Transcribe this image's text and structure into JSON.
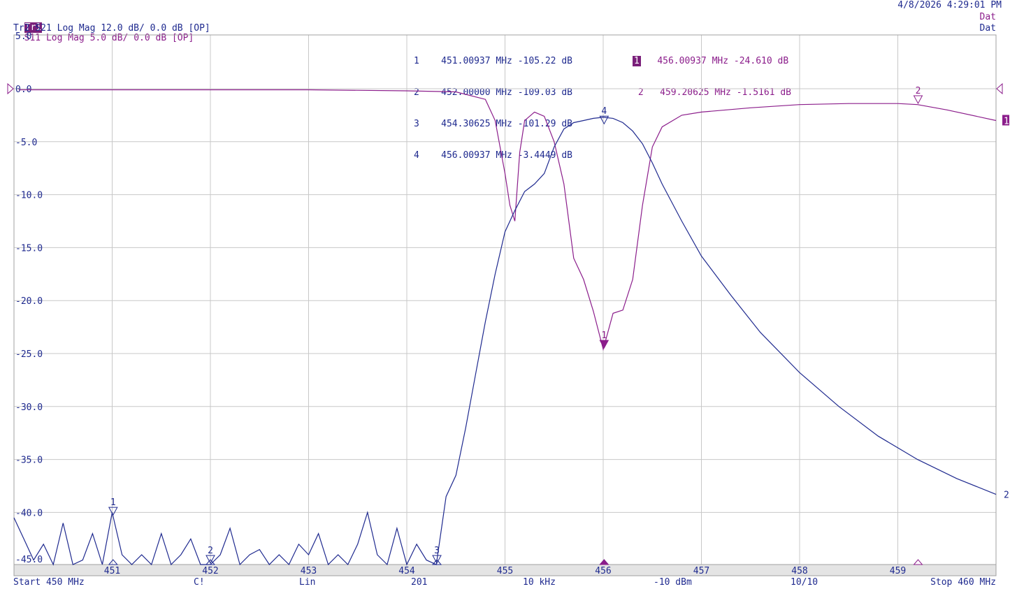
{
  "header": {
    "tr1_badge": "Tr1",
    "tr1_text": "S11 Log Mag 5.0 dB/ 0.0 dB [OP]",
    "tr2_text": "Tr2 S21 Log Mag 12.0 dB/ 0.0 dB [OP]",
    "datetime": "4/8/2026 4:29:01 PM",
    "dat1": "Dat",
    "dat2": "Dat"
  },
  "footer": {
    "start": "Start 450 MHz",
    "cal": "C!",
    "sweep": "Lin",
    "points": "201",
    "ifbw": "10 kHz",
    "power": "-10 dBm",
    "avg": "10/10",
    "stop": "Stop 460 MHz"
  },
  "markers_tr2": [
    {
      "id": "1",
      "freq": "451.00937 MHz",
      "val": "-105.22 dB"
    },
    {
      "id": "2",
      "freq": "452.00000 MHz",
      "val": "-109.03 dB"
    },
    {
      "id": "3",
      "freq": "454.30625 MHz",
      "val": "-101.29 dB"
    },
    {
      "id": "4",
      "freq": "456.00937 MHz",
      "val": "-3.4449 dB"
    }
  ],
  "markers_tr1": [
    {
      "id": "1",
      "freq": "456.00937 MHz",
      "val": "-24.610 dB"
    },
    {
      "id": "2",
      "freq": "459.20625 MHz",
      "val": "-1.5161 dB"
    }
  ],
  "colors": {
    "s11": "#8b1d8b",
    "s21": "#1f2a8f",
    "grid": "#c8c8c8"
  },
  "chart_data": {
    "type": "line",
    "xlim": [
      450,
      460
    ],
    "ylim": [
      -45.5,
      5.0
    ],
    "x_ticks": [
      "451",
      "452",
      "453",
      "454",
      "455",
      "456",
      "457",
      "458",
      "459"
    ],
    "y_ticks": [
      "5.0",
      "0.0",
      "-5.0",
      "-10.0",
      "-15.0",
      "-20.0",
      "-25.0",
      "-30.0",
      "-35.0",
      "-40.0",
      "-45.0"
    ],
    "grid": true,
    "series": [
      {
        "name": "S11",
        "x": [
          450.05,
          451,
          452,
          453,
          454,
          454.5,
          454.8,
          454.9,
          455.0,
          455.05,
          455.1,
          455.15,
          455.2,
          455.3,
          455.4,
          455.5,
          455.6,
          455.7,
          455.8,
          455.9,
          456.0,
          456.1,
          456.2,
          456.3,
          456.4,
          456.5,
          456.6,
          456.8,
          457,
          457.5,
          458,
          458.5,
          459,
          459.2,
          459.5,
          460
        ],
        "y": [
          -0.1,
          -0.1,
          -0.1,
          -0.1,
          -0.2,
          -0.3,
          -1.0,
          -3.0,
          -8.0,
          -11.0,
          -12.5,
          -6.0,
          -3.0,
          -2.2,
          -2.6,
          -5.0,
          -9.0,
          -16.0,
          -18.0,
          -21.0,
          -24.6,
          -21.2,
          -20.9,
          -18.0,
          -11.0,
          -5.5,
          -3.6,
          -2.5,
          -2.2,
          -1.8,
          -1.5,
          -1.4,
          -1.4,
          -1.5,
          -2.0,
          -3.0
        ]
      },
      {
        "name": "S21",
        "x": [
          450,
          450.1,
          450.2,
          450.3,
          450.4,
          450.5,
          450.6,
          450.7,
          450.8,
          450.9,
          451.0,
          451.1,
          451.2,
          451.3,
          451.4,
          451.5,
          451.6,
          451.7,
          451.8,
          451.9,
          452.0,
          452.1,
          452.2,
          452.3,
          452.4,
          452.5,
          452.6,
          452.7,
          452.8,
          452.9,
          453.0,
          453.1,
          453.2,
          453.3,
          453.4,
          453.5,
          453.6,
          453.7,
          453.8,
          453.9,
          454.0,
          454.1,
          454.2,
          454.3,
          454.4,
          454.5,
          454.6,
          454.7,
          454.8,
          454.9,
          455.0,
          455.1,
          455.2,
          455.3,
          455.4,
          455.5,
          455.6,
          455.7,
          455.8,
          455.9,
          456.0,
          456.1,
          456.2,
          456.3,
          456.4,
          456.5,
          456.6,
          456.8,
          457.0,
          457.3,
          457.6,
          458.0,
          458.4,
          458.8,
          459.2,
          459.6,
          460.0
        ],
        "y": [
          -40.5,
          -42.5,
          -44.5,
          -43.0,
          -45.5,
          -41.0,
          -45.5,
          -44.5,
          -42.0,
          -45.5,
          -40.0,
          -44.0,
          -45.5,
          -44.0,
          -45.5,
          -42.0,
          -45.5,
          -44.0,
          -42.5,
          -45.5,
          -45.0,
          -44.0,
          -41.5,
          -45.5,
          -44.0,
          -43.5,
          -45.5,
          -44.0,
          -45.5,
          -43.0,
          -44.0,
          -42.0,
          -45.5,
          -44.0,
          -45.5,
          -43.0,
          -40.0,
          -44.0,
          -45.5,
          -41.5,
          -45.5,
          -43.0,
          -44.5,
          -45.5,
          -38.5,
          -36.5,
          -32.0,
          -27.0,
          -22.0,
          -17.5,
          -13.5,
          -11.5,
          -9.7,
          -9.0,
          -8.0,
          -5.5,
          -3.8,
          -3.2,
          -3.0,
          -2.8,
          -2.7,
          -2.8,
          -3.2,
          -4.0,
          -5.2,
          -7.0,
          -9.0,
          -12.5,
          -15.8,
          -19.5,
          -23.0,
          -26.8,
          -30.0,
          -32.8,
          -35.0,
          -36.8,
          -38.3
        ]
      }
    ],
    "markers": [
      {
        "series": "S21",
        "label": "1",
        "x": 451.00937,
        "y": -105.22
      },
      {
        "series": "S21",
        "label": "2",
        "x": 452.0,
        "y": -109.03
      },
      {
        "series": "S21",
        "label": "3",
        "x": 454.30625,
        "y": -101.29
      },
      {
        "series": "S21",
        "label": "4",
        "x": 456.00937,
        "y": -3.4449
      },
      {
        "series": "S11",
        "label": "1",
        "x": 456.00937,
        "y": -24.61
      },
      {
        "series": "S11",
        "label": "2",
        "x": 459.20625,
        "y": -1.5161
      }
    ]
  }
}
